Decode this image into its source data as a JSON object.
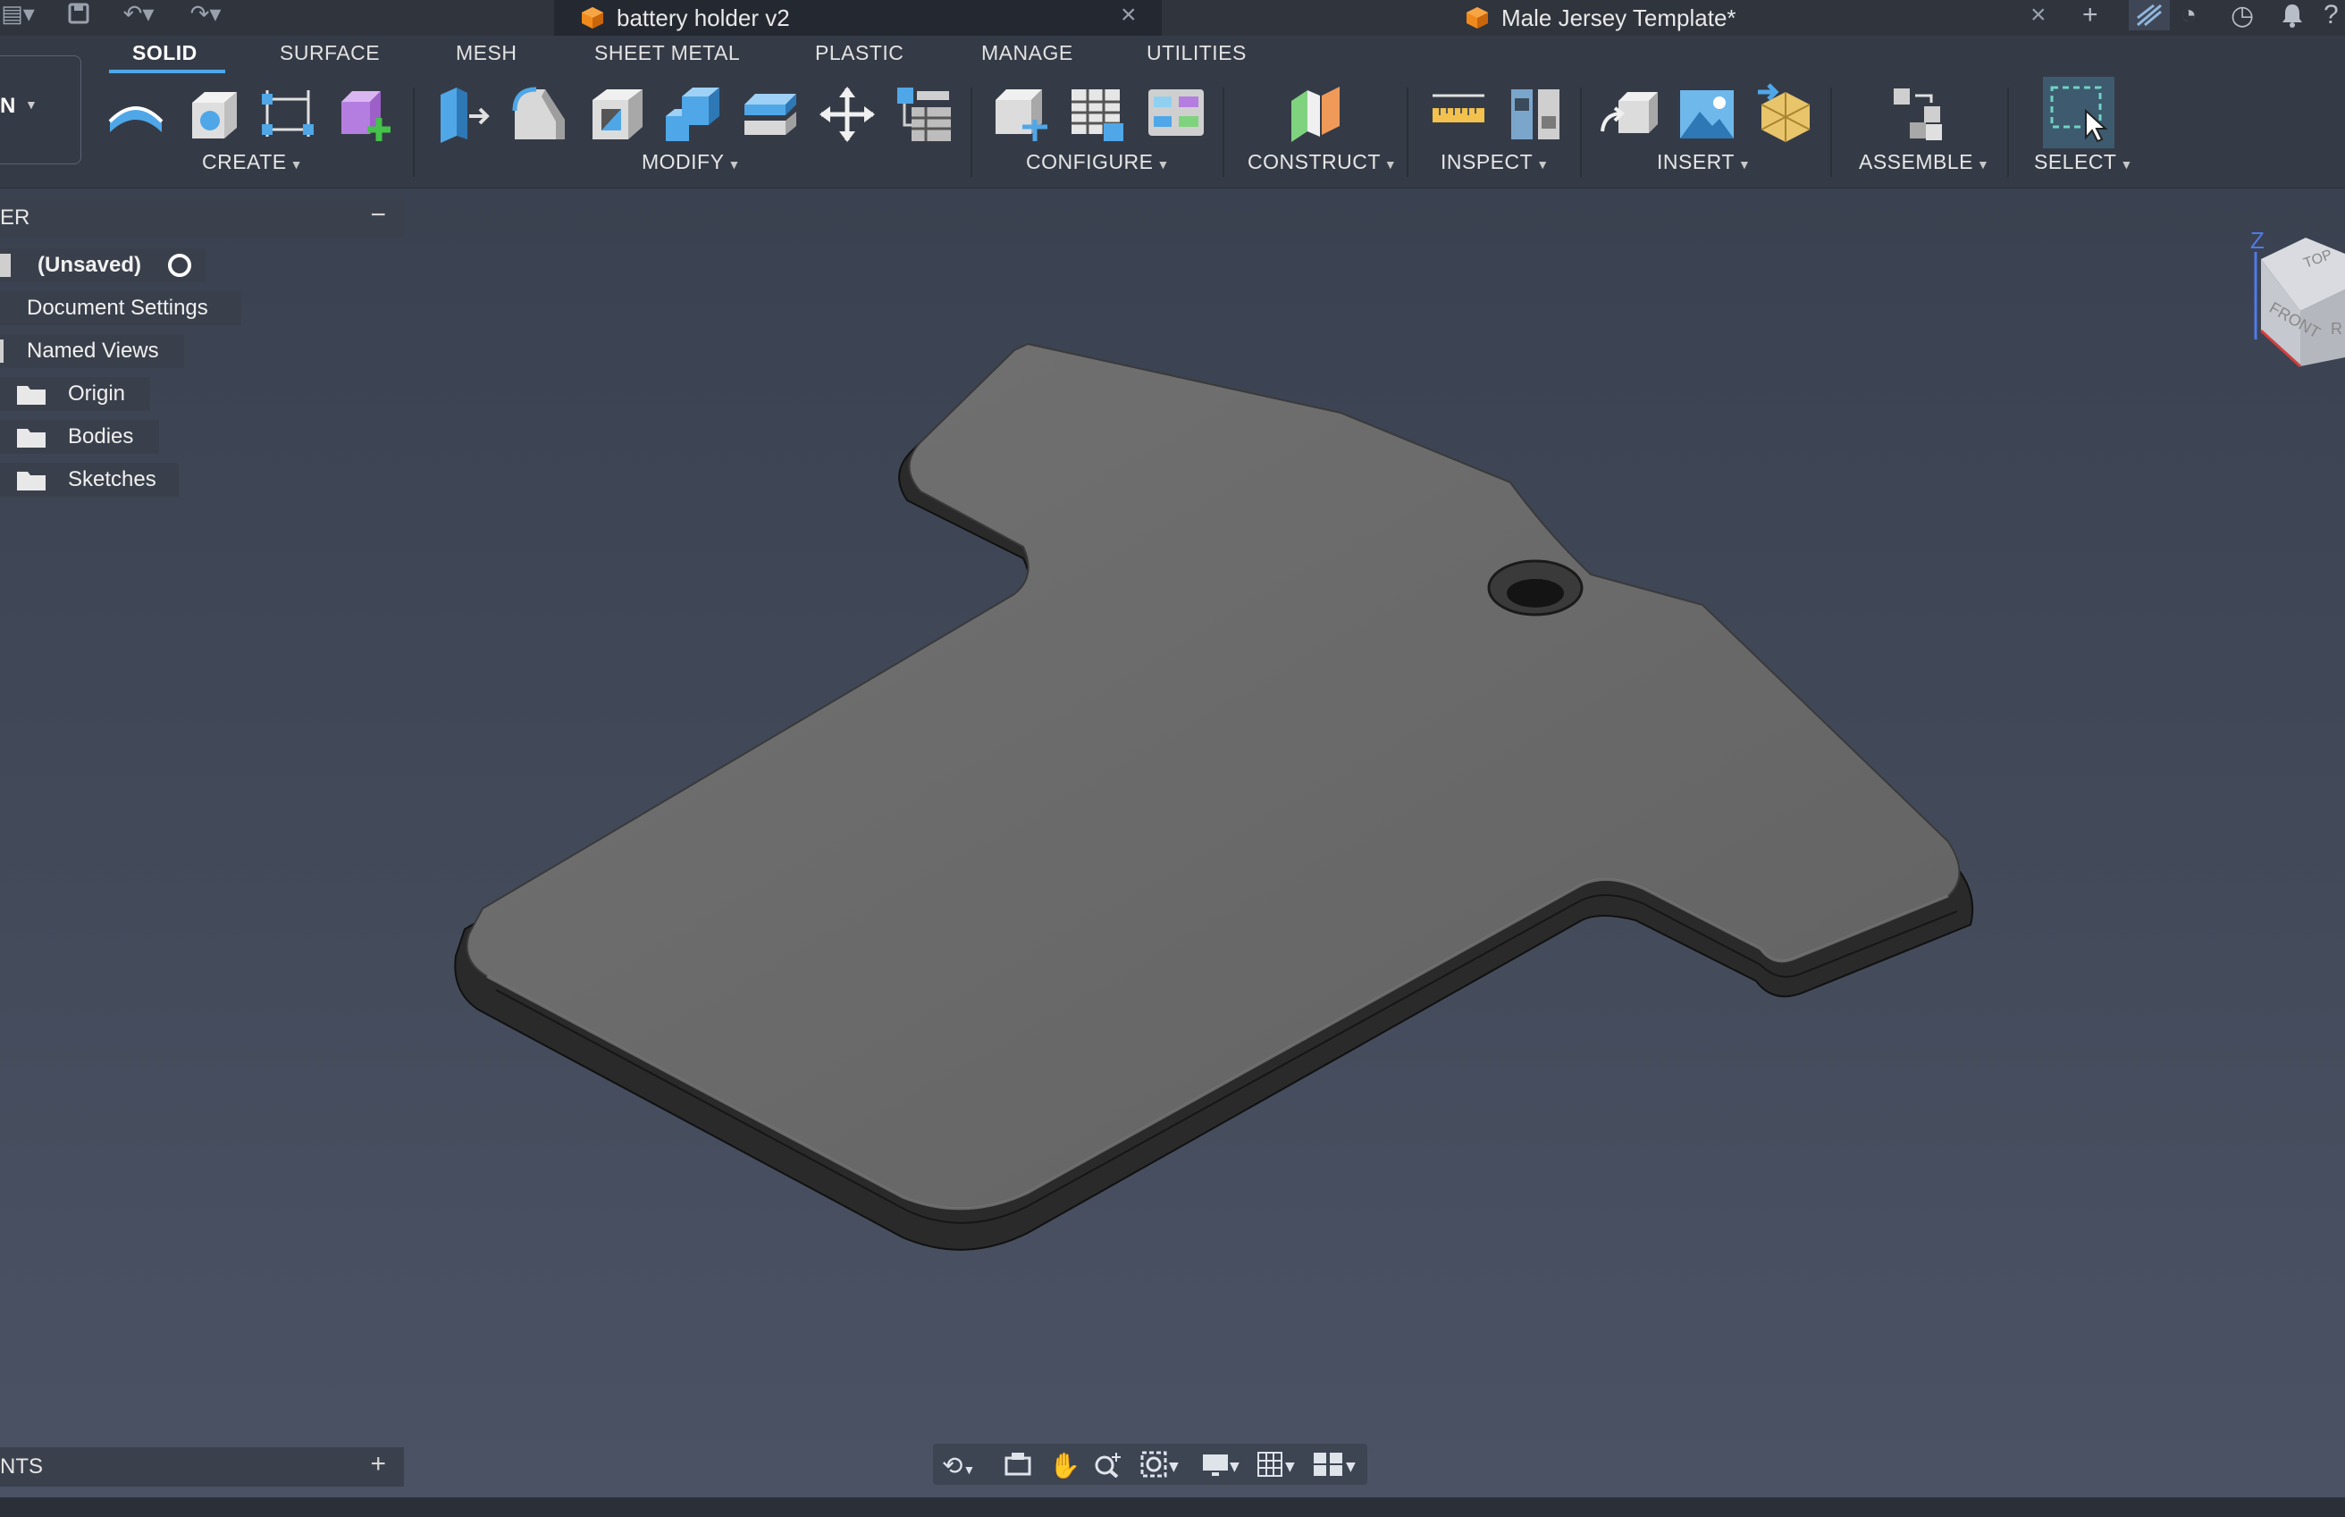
{
  "tabs": [
    {
      "label": "battery holder v2",
      "active": true
    },
    {
      "label": "Male Jersey Template*",
      "active": false
    }
  ],
  "toolbar": {
    "workspace_label": "N",
    "workspace_tabs": [
      {
        "label": "SOLID",
        "active": true
      },
      {
        "label": "SURFACE"
      },
      {
        "label": "MESH"
      },
      {
        "label": "SHEET METAL"
      },
      {
        "label": "PLASTIC"
      },
      {
        "label": "MANAGE"
      },
      {
        "label": "UTILITIES"
      }
    ],
    "groups": {
      "create": "CREATE",
      "modify": "MODIFY",
      "configure": "CONFIGURE",
      "construct": "CONSTRUCT",
      "inspect": "INSPECT",
      "insert": "INSERT",
      "assemble": "ASSEMBLE",
      "select": "SELECT"
    }
  },
  "browser": {
    "title": "ER",
    "collapse_symbol": "−",
    "root": "(Unsaved)",
    "items": [
      "Document Settings",
      "Named Views",
      "Origin",
      "Bodies",
      "Sketches"
    ]
  },
  "comments": {
    "title": "NTS",
    "add_symbol": "+"
  },
  "viewcube": {
    "axis_label": "Z",
    "faces": [
      "TOP",
      "FRONT",
      "R"
    ]
  },
  "colors": {
    "accent": "#4fa7e8",
    "body_fill": "#6b6b6b",
    "viewport_bg": "#434b5b",
    "toolbar_bg": "#353b46"
  }
}
